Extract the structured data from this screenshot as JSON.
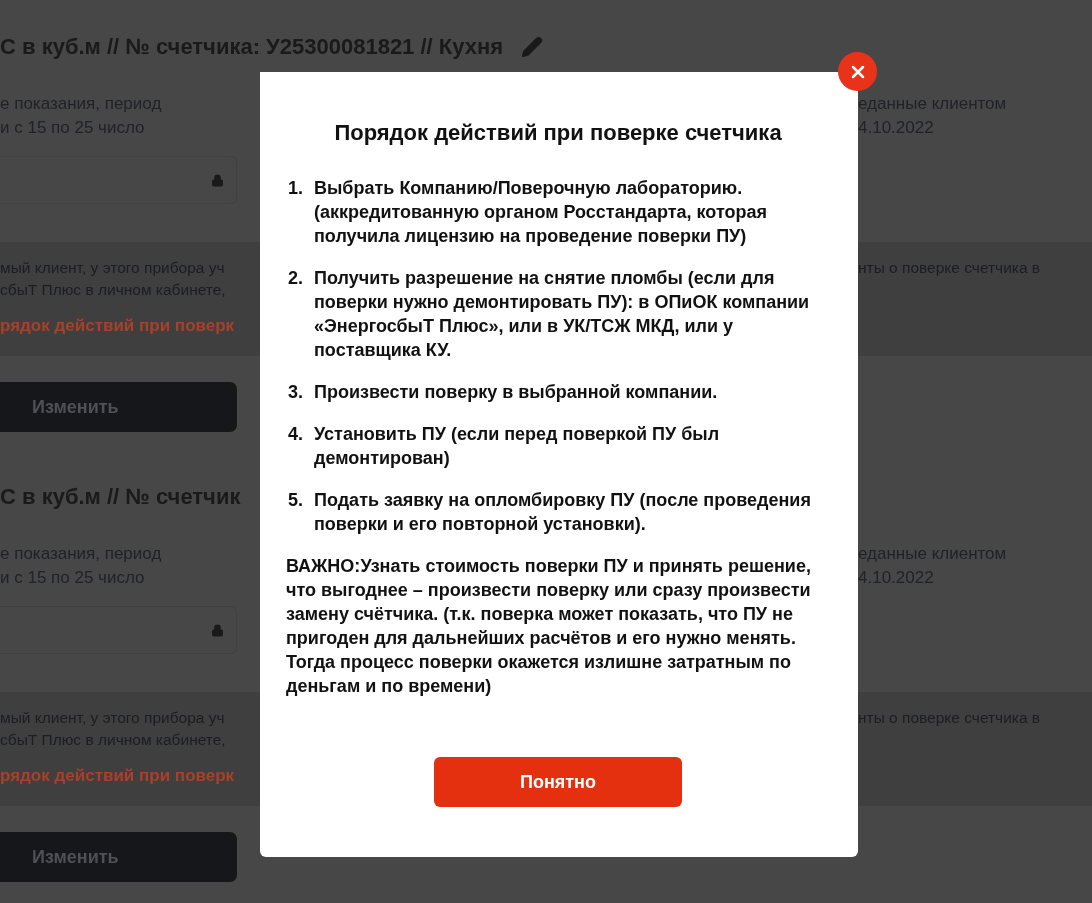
{
  "meter_blocks": [
    {
      "title": "С в куб.м // № счетчика: У25300081821 // Кухня",
      "editable": true,
      "hint_lines": [
        "е показания, период",
        "и с 15 по 25 число"
      ],
      "right_lines": [
        "еданные клиентом",
        "4.10.2022"
      ],
      "locked": true,
      "notice_lines": [
        "мый клиент, у этого прибора уч",
        "сбыТ Плюс в личном кабинете, "
      ],
      "notice_right": "нты о поверке счетчика в",
      "notice_link": "рядок действий при поверк",
      "button": "Изменить"
    },
    {
      "title": "С в куб.м // № счетчик",
      "hint_lines": [
        "е показания, период",
        "и с 15 по 25 число"
      ],
      "right_lines": [
        "еданные клиентом",
        "4.10.2022"
      ],
      "locked": true,
      "notice_lines": [
        "мый клиент, у этого прибора уч",
        "сбыТ Плюс в личном кабинете, "
      ],
      "notice_right": "нты о поверке счетчика в",
      "notice_link": "рядок действий при поверк",
      "button": "Изменить"
    }
  ],
  "modal": {
    "title": "Порядок действий при поверке счетчика",
    "steps": [
      {
        "number": "1.",
        "text": "Выбрать Компанию/Поверочную лабораторию. (аккредитованную органом Росстандарта, которая получила лицензию на проведение поверки ПУ)"
      },
      {
        "number": "2.",
        "text": "Получить разрешение на снятие пломбы (если для поверки нужно демонтировать ПУ): в ОПиОК компании «ЭнергосбыТ Плюс», или в УК/ТСЖ МКД, или у поставщика КУ."
      },
      {
        "number": "3.",
        "text": "Произвести поверку в выбранной компании."
      },
      {
        "number": "4.",
        "text": "Установить ПУ (если перед поверкой ПУ был демонтирован)"
      },
      {
        "number": "5.",
        "text": "Подать заявку на опломбировку ПУ (после проведения поверки и его повторной установки)."
      }
    ],
    "note": "**ВАЖНО:**Узнать стоимость поверки ПУ и принять решение, что выгоднее – произвести поверку или сразу произвести замену счётчика. (т.к. поверка может показать, что ПУ не пригоден для дальнейших расчётов и его нужно менять. Тогда процесс поверки окажется излишне затратным по деньгам и по времени)",
    "button": "Понятно"
  }
}
